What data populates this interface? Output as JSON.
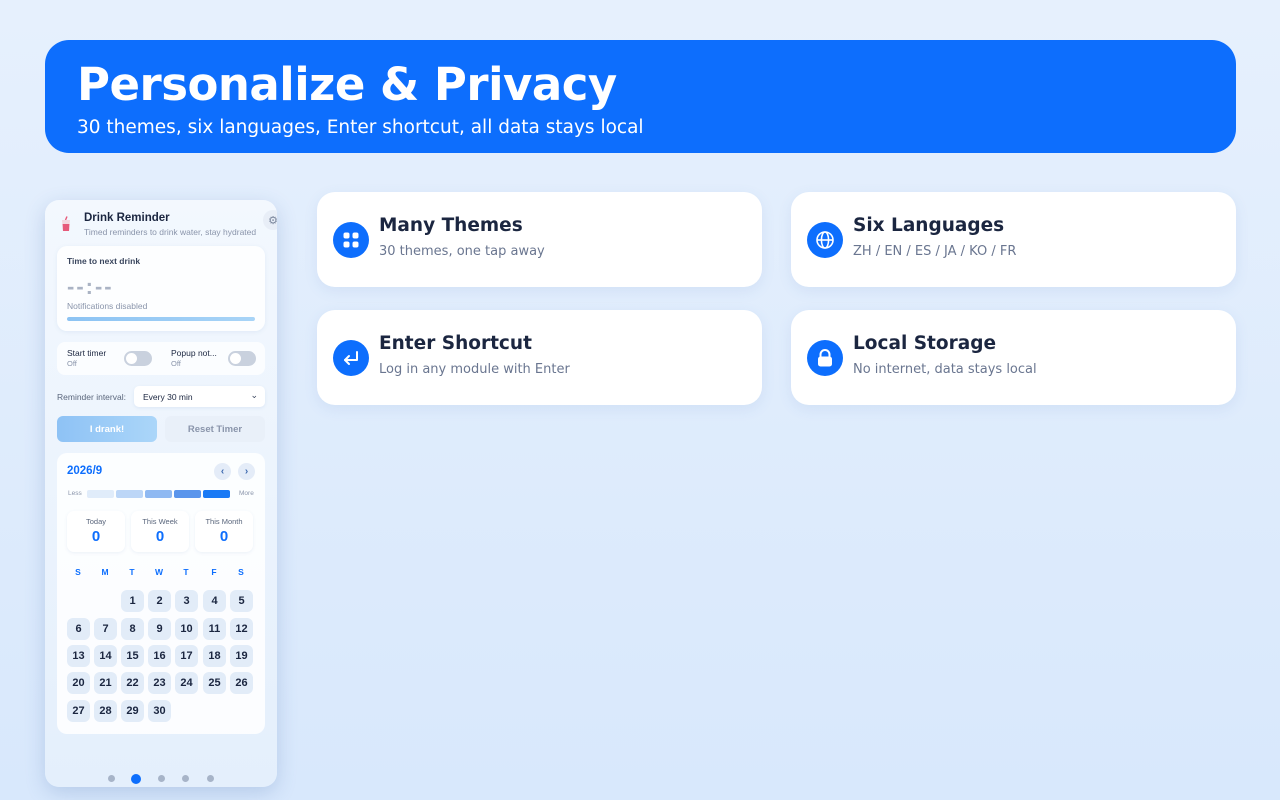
{
  "hero": {
    "title": "Personalize & Privacy",
    "subtitle": "30 themes, six languages, Enter shortcut, all data stays local"
  },
  "features": [
    {
      "title": "Many Themes",
      "desc": "30 themes, one tap away",
      "icon": "grid-icon"
    },
    {
      "title": "Six Languages",
      "desc": "ZH / EN / ES / JA / KO / FR",
      "icon": "globe-icon"
    },
    {
      "title": "Enter Shortcut",
      "desc": "Log in any module with Enter",
      "icon": "enter-key-icon"
    },
    {
      "title": "Local Storage",
      "desc": "No internet, data stays local",
      "icon": "lock-icon"
    }
  ],
  "app": {
    "title": "Drink Reminder",
    "subtitle": "Timed reminders to drink water, stay hydrated",
    "timer": {
      "label": "Time to next drink",
      "display": "--:--",
      "status": "Notifications disabled"
    },
    "toggles": [
      {
        "label": "Start timer",
        "state": "Off"
      },
      {
        "label": "Popup not...",
        "state": "Off"
      }
    ],
    "interval": {
      "label": "Reminder interval:",
      "value": "Every 30 min"
    },
    "buttons": {
      "drank": "I drank!",
      "reset": "Reset Timer"
    },
    "calendar": {
      "month": "2026/9",
      "legend_less": "Less",
      "legend_more": "More",
      "stats": [
        {
          "label": "Today",
          "value": "0"
        },
        {
          "label": "This Week",
          "value": "0"
        },
        {
          "label": "This Month",
          "value": "0"
        }
      ],
      "weekdays": [
        "S",
        "M",
        "T",
        "W",
        "T",
        "F",
        "S"
      ],
      "first_weekday": 2,
      "days_in_month": 30
    }
  },
  "pager": {
    "count": 5,
    "active": 1
  },
  "colors": {
    "accent": "#0d6efd",
    "heat": [
      "#e0ecfa",
      "#bcd6f7",
      "#8fb9f2",
      "#5a95ec",
      "#1a7af5"
    ]
  }
}
